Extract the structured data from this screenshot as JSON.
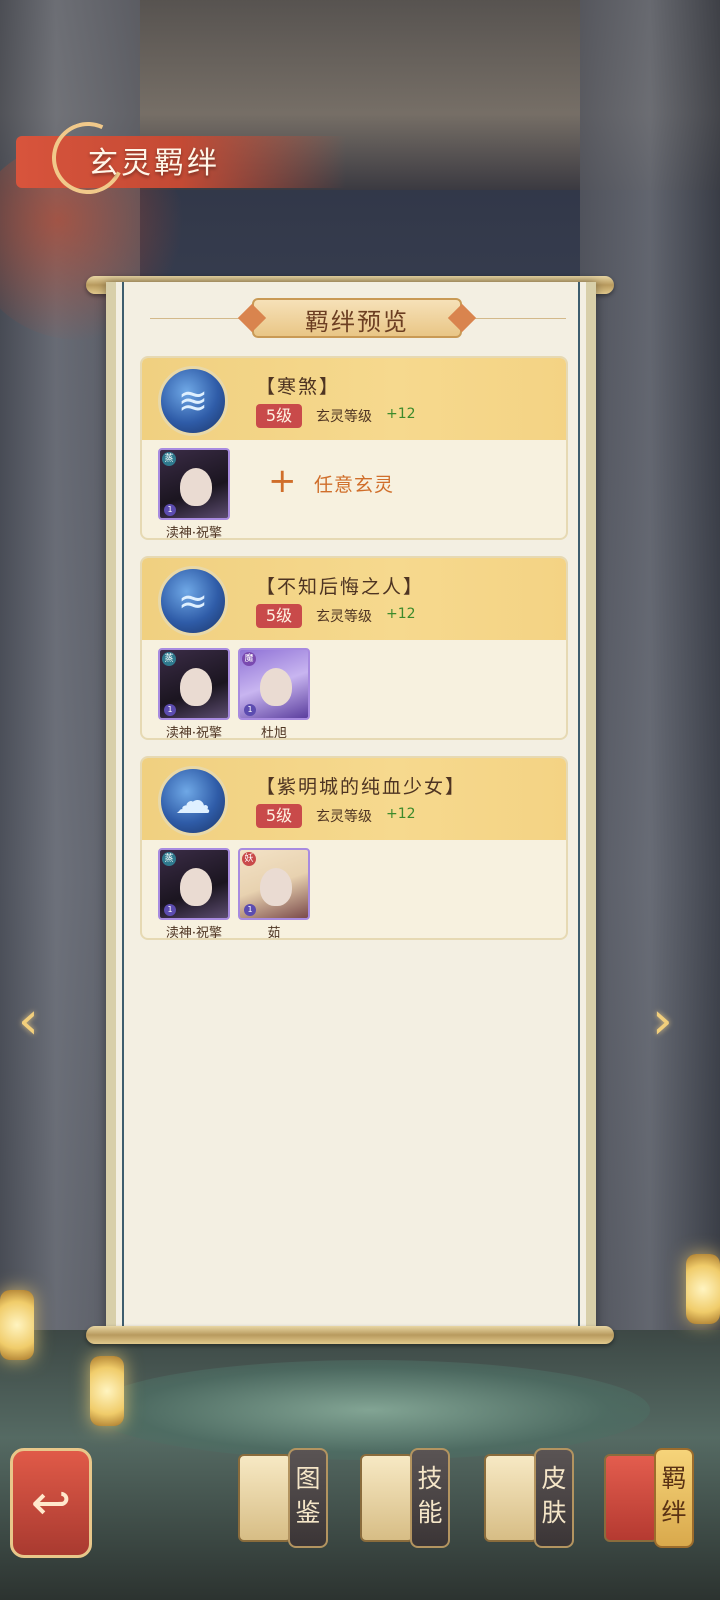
{
  "header": {
    "title": "玄灵羁绊"
  },
  "panel": {
    "title": "羁绊预览"
  },
  "bonds": [
    {
      "name": "【寒煞】",
      "level_badge": "5级",
      "level_label": "玄灵等级",
      "level_bonus": "+12",
      "icon": "wind-swirl-icon",
      "members": [
        {
          "name": "渎神·祝擎",
          "badge": "蒸",
          "level": "1",
          "style": "dark"
        }
      ],
      "any_label": "任意玄灵"
    },
    {
      "name": "【不知后悔之人】",
      "level_badge": "5级",
      "level_label": "玄灵等级",
      "level_bonus": "+12",
      "icon": "wave-swirl-icon",
      "members": [
        {
          "name": "渎神·祝擎",
          "badge": "蒸",
          "level": "1",
          "style": "dark"
        },
        {
          "name": "杜旭",
          "badge": "魔",
          "level": "1",
          "style": "violet"
        }
      ]
    },
    {
      "name": "【紫明城的纯血少女】",
      "level_badge": "5级",
      "level_label": "玄灵等级",
      "level_bonus": "+12",
      "icon": "cloud-swirl-icon",
      "members": [
        {
          "name": "渎神·祝擎",
          "badge": "蒸",
          "level": "1",
          "style": "dark"
        },
        {
          "name": "茹",
          "badge": "妖",
          "level": "1",
          "style": "light"
        }
      ]
    }
  ],
  "nav": {
    "back_icon": "back-arrow-icon",
    "items": [
      {
        "label": "图鉴",
        "icon": "book-icon",
        "active": false
      },
      {
        "label": "技能",
        "icon": "sword-icon",
        "active": false
      },
      {
        "label": "皮肤",
        "icon": "robe-icon",
        "active": false
      },
      {
        "label": "羁绊",
        "icon": "bond-scroll-icon",
        "active": true
      }
    ]
  },
  "colors": {
    "accent_red": "#c94a4a",
    "bonus_green": "#3c8a2c",
    "gold": "#f0d080"
  }
}
